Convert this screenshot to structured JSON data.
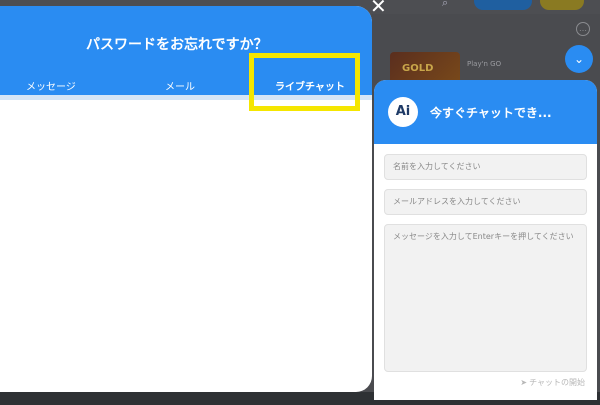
{
  "modal": {
    "title": "パスワードをお忘れですか？",
    "tabs": [
      {
        "label": "メッセージ"
      },
      {
        "label": "メール"
      },
      {
        "label": "ライブチャット"
      }
    ]
  },
  "chat": {
    "title": "今すぐチャットでき...",
    "logo_text": "Ai",
    "name_placeholder": "名前を入力してください",
    "email_placeholder": "メールアドレスを入力してください",
    "message_placeholder": "メッセージを入力してEnterキーを押してください",
    "send_label": "チャットの開始",
    "minimize_icon": "chevron-down-icon"
  },
  "background": {
    "provider": "Play'n GO",
    "game_title": "GOLD",
    "close_icon": "close-icon",
    "more_icon": "more-icon"
  },
  "colors": {
    "primary": "#2a8cf2",
    "highlight": "#f5e600"
  }
}
